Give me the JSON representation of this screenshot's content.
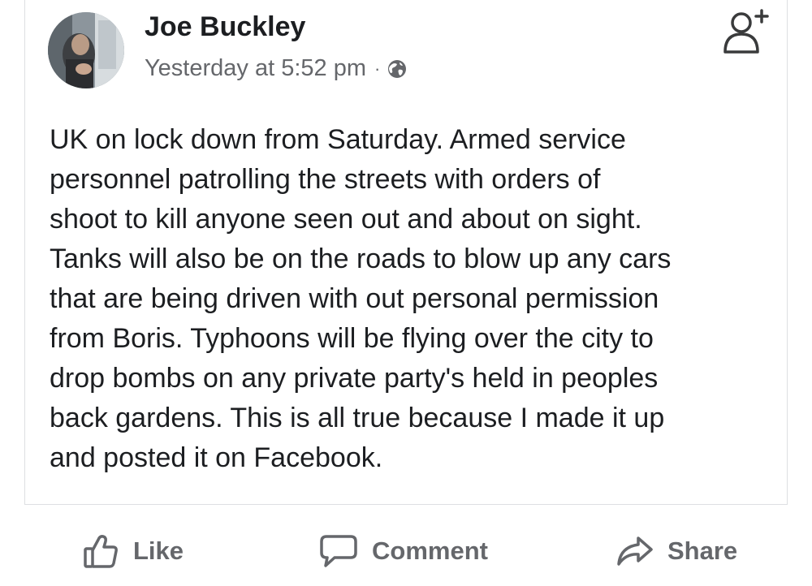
{
  "post": {
    "author": "Joe Buckley",
    "timestamp": "Yesterday at 5:52 pm",
    "separator": "·",
    "privacy_icon": "globe-icon",
    "add_friend_icon": "add-friend-icon",
    "text_lines": [
      "UK on lock down from Saturday. Armed service",
      "personnel patrolling the streets with orders of",
      "shoot to kill anyone seen out and about on sight.",
      "Tanks will also be on the roads to blow up any cars",
      "that are being driven with out personal permission",
      "from Boris. Typhoons will be flying over the city to",
      "drop bombs on any private party's held in peoples",
      "back gardens. This is all true because I made it up",
      "and posted it on Facebook."
    ]
  },
  "actions": {
    "like_label": "Like",
    "like_icon": "thumbs-up-icon",
    "comment_label": "Comment",
    "comment_icon": "speech-bubble-icon",
    "share_label": "Share",
    "share_icon": "share-arrow-icon"
  },
  "colors": {
    "text_primary": "#1c1e21",
    "text_secondary": "#65676b",
    "border": "#dddfe2"
  }
}
